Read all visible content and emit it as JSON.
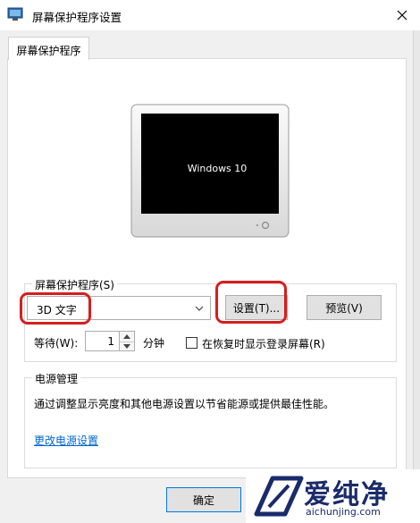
{
  "window": {
    "title": "屏幕保护程序设置",
    "icon": "monitor-settings-icon",
    "close_icon": "close-icon"
  },
  "tab": {
    "label": "屏幕保护程序"
  },
  "preview": {
    "screen_text": "Windows 10"
  },
  "screensaver": {
    "group_label": "屏幕保护程序(S)",
    "selected": "3D 文字",
    "settings_button": "设置(T)...",
    "preview_button": "预览(V)",
    "wait_label": "等待(W):",
    "wait_value": "1",
    "minutes_label": "分钟",
    "resume_logon_label": "在恢复时显示登录屏幕(R)",
    "resume_logon_checked": false
  },
  "power": {
    "group_label": "电源管理",
    "description": "通过调整显示亮度和其他电源设置以节省能源或提供最佳性能。",
    "link": "更改电源设置"
  },
  "footer": {
    "ok_button": "确定"
  },
  "watermark": {
    "main": "爱纯净",
    "sub": "aichunjing.com"
  },
  "colors": {
    "highlight": "#d61e1e",
    "link": "#0066cc",
    "ok_border": "#0078d7"
  }
}
